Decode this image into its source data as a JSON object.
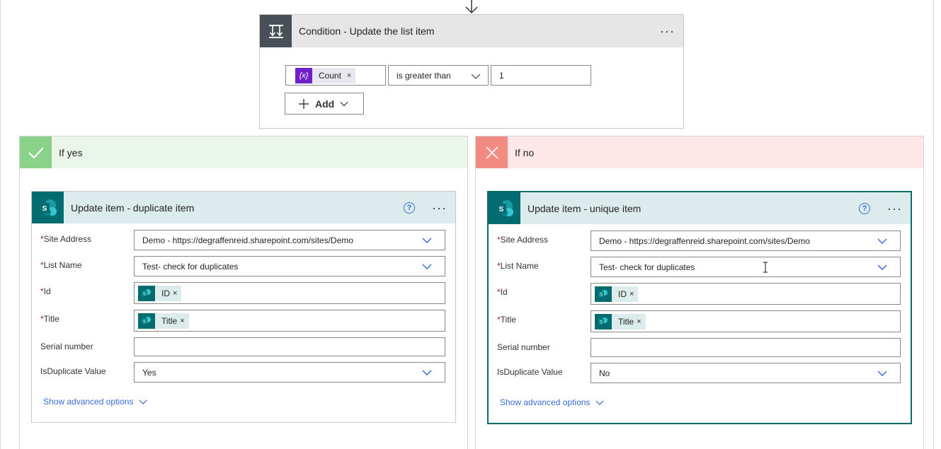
{
  "condition": {
    "title": "Condition - Update the list item",
    "menu_glyph": "···",
    "token_symbol": "{x}",
    "token_label": "Count",
    "token_remove": "×",
    "operator": "is greater than",
    "value": "1",
    "add_label": "Add"
  },
  "branch_yes": {
    "title": "If yes",
    "color": "#8ad18a",
    "action": {
      "title": "Update item - duplicate item",
      "help_glyph": "?",
      "menu_glyph": "···",
      "site_address_label": "Site Address",
      "site_address_value": "Demo - https://degraffenreid.sharepoint.com/sites/Demo",
      "list_name_label": "List Name",
      "list_name_value": "Test- check for duplicates",
      "id_label": "Id",
      "id_token": "ID",
      "title_label": "Title",
      "title_token": "Title",
      "token_remove": "×",
      "serial_label": "Serial number",
      "serial_value": "",
      "isdup_label": "IsDuplicate Value",
      "isdup_value": "Yes",
      "advanced_label": "Show advanced options"
    }
  },
  "branch_no": {
    "title": "If no",
    "color": "#f28b82",
    "action": {
      "title": "Update item - unique item",
      "help_glyph": "?",
      "menu_glyph": "···",
      "site_address_label": "Site Address",
      "site_address_value": "Demo - https://degraffenreid.sharepoint.com/sites/Demo",
      "list_name_label": "List Name",
      "list_name_value": "Test- check for duplicates",
      "id_label": "Id",
      "id_token": "ID",
      "title_label": "Title",
      "title_token": "Title",
      "token_remove": "×",
      "serial_label": "Serial number",
      "serial_value": "",
      "isdup_label": "IsDuplicate Value",
      "isdup_value": "No",
      "advanced_label": "Show advanced options"
    }
  },
  "required_marker": "*",
  "icons": [
    "down-arrow-icon",
    "condition-icon",
    "checkmark-icon",
    "close-x-icon",
    "sharepoint-icon",
    "chevron-down-icon",
    "plus-icon",
    "help-icon",
    "more-options-icon"
  ]
}
